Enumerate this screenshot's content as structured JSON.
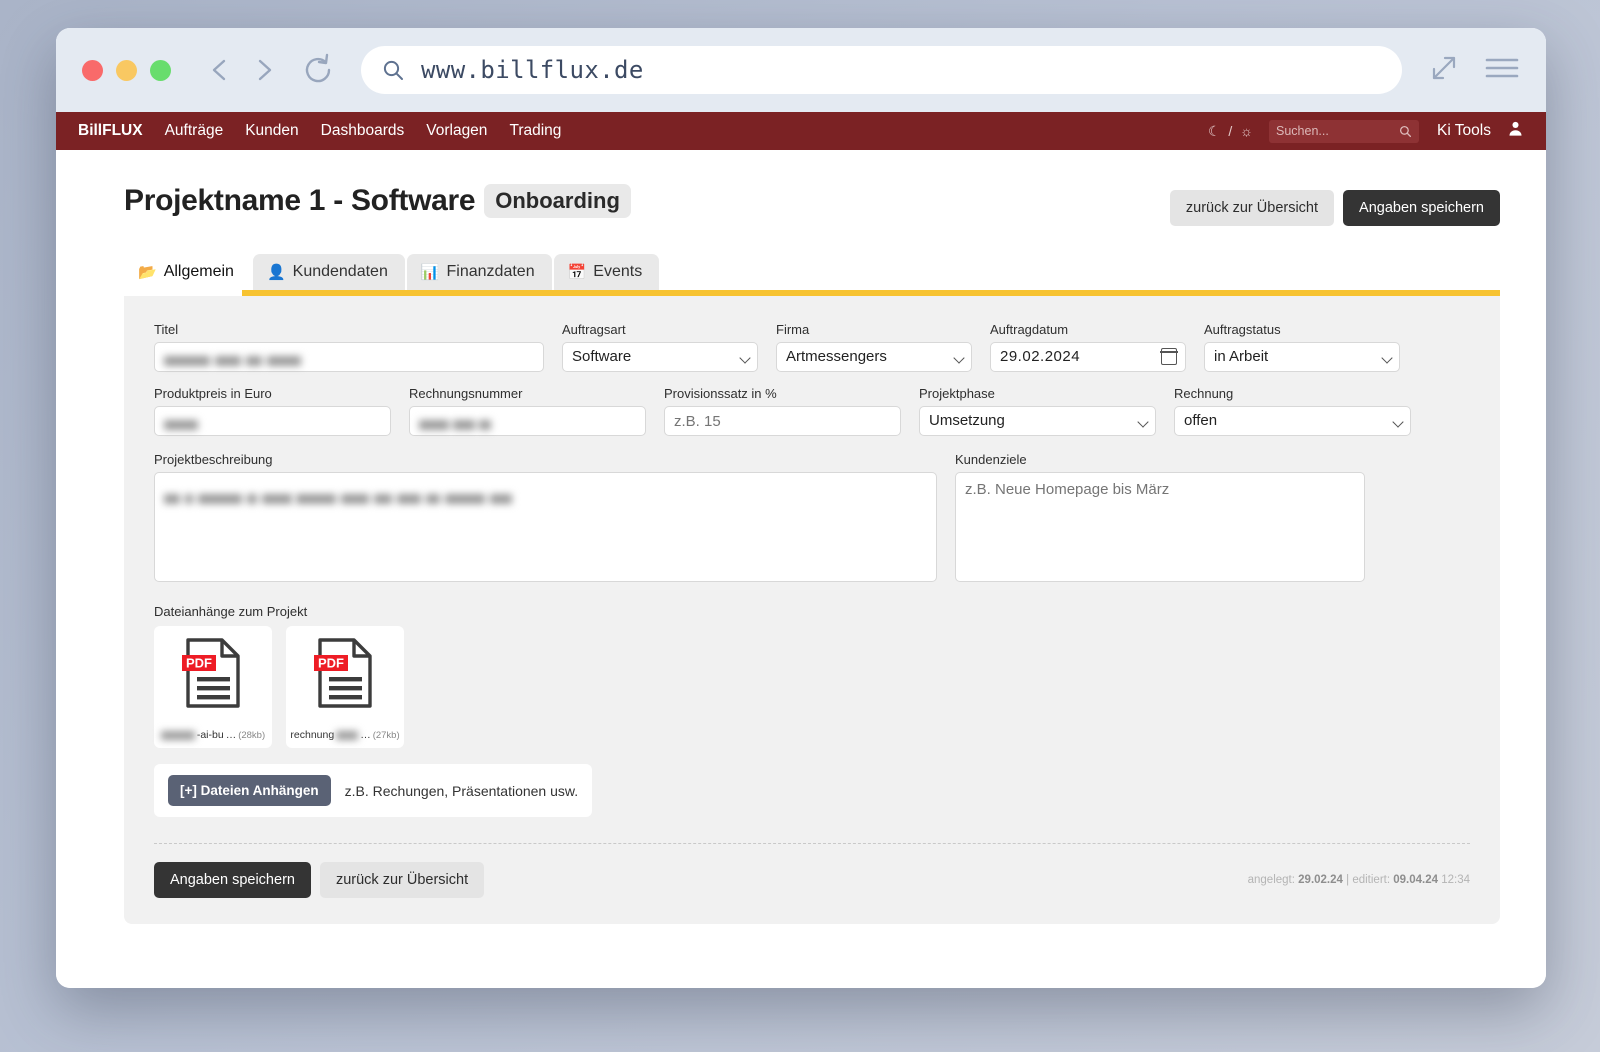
{
  "browser": {
    "url": "www.billflux.de",
    "search_icon": "search-icon",
    "back_icon": "chevron-left-icon",
    "forward_icon": "chevron-right-icon",
    "reload_icon": "reload-icon",
    "expand_icon": "expand-arrows-icon",
    "menu_icon": "hamburger-menu-icon"
  },
  "appnav": {
    "brand": "BillFLUX",
    "items": [
      {
        "label": "Aufträge"
      },
      {
        "label": "Kunden"
      },
      {
        "label": "Dashboards"
      },
      {
        "label": "Vorlagen"
      },
      {
        "label": "Trading"
      }
    ],
    "theme_toggle": "☾ / ☼",
    "search_placeholder": "Suchen...",
    "search_icon": "search-icon",
    "ki_tools": "Ki Tools",
    "user_icon": "user-avatar-icon",
    "bg_color": "#7b2224"
  },
  "header": {
    "title": "Projektname 1 - Software",
    "badge": "Onboarding",
    "back_button": "zurück zur Übersicht",
    "save_button": "Angaben speichern"
  },
  "tabs": [
    {
      "label": "Allgemein",
      "icon": "📂",
      "icon_name": "open-folder-icon",
      "active": true
    },
    {
      "label": "Kundendaten",
      "icon": "👤",
      "icon_name": "person-icon",
      "active": false
    },
    {
      "label": "Finanzdaten",
      "icon": "📊",
      "icon_name": "bar-chart-icon",
      "active": false
    },
    {
      "label": "Events",
      "icon": "📅",
      "icon_name": "calendar-icon",
      "active": false
    }
  ],
  "accent_color": "#f7c331",
  "form": {
    "titel": {
      "label": "Titel",
      "value": "",
      "redacted": true
    },
    "auftragsart": {
      "label": "Auftragsart",
      "value": "Software"
    },
    "firma": {
      "label": "Firma",
      "value": "Artmessengers"
    },
    "auftragdatum": {
      "label": "Auftragdatum",
      "value": "29.02.2024"
    },
    "auftragstatus": {
      "label": "Auftragstatus",
      "value": "in Arbeit"
    },
    "produktpreis": {
      "label": "Produktpreis in Euro",
      "value": "",
      "redacted": true
    },
    "rechnungsnummer": {
      "label": "Rechnungsnummer",
      "value": "",
      "redacted": true
    },
    "provisionssatz": {
      "label": "Provisionssatz in %",
      "value": "",
      "placeholder": "z.B. 15"
    },
    "projektphase": {
      "label": "Projektphase",
      "value": "Umsetzung"
    },
    "rechnung": {
      "label": "Rechnung",
      "value": "offen"
    },
    "projektbeschreibung": {
      "label": "Projektbeschreibung",
      "value": "",
      "redacted": true
    },
    "kundenziele": {
      "label": "Kundenziele",
      "value": "",
      "placeholder": "z.B. Neue Homepage bis März"
    }
  },
  "attachments": {
    "label": "Dateianhänge zum Projekt",
    "files": [
      {
        "name_visible": "-ai-bu",
        "trail": "…",
        "size": "(28kb)",
        "type": "PDF",
        "redacted_prefix": true
      },
      {
        "name_visible": "rechnung",
        "trail": "…",
        "size": "(27kb)",
        "type": "PDF",
        "redacted_suffix": true
      }
    ],
    "attach_button": "[+] Dateien Anhängen",
    "attach_hint": "z.B. Rechungen, Präsentationen usw."
  },
  "footer": {
    "save_button": "Angaben speichern",
    "back_button": "zurück zur Übersicht",
    "created_label": "angelegt:",
    "created_value": "29.02.24",
    "separator": "|",
    "edited_label": "editiert:",
    "edited_value": "09.04.24",
    "edited_time": "12:34"
  }
}
